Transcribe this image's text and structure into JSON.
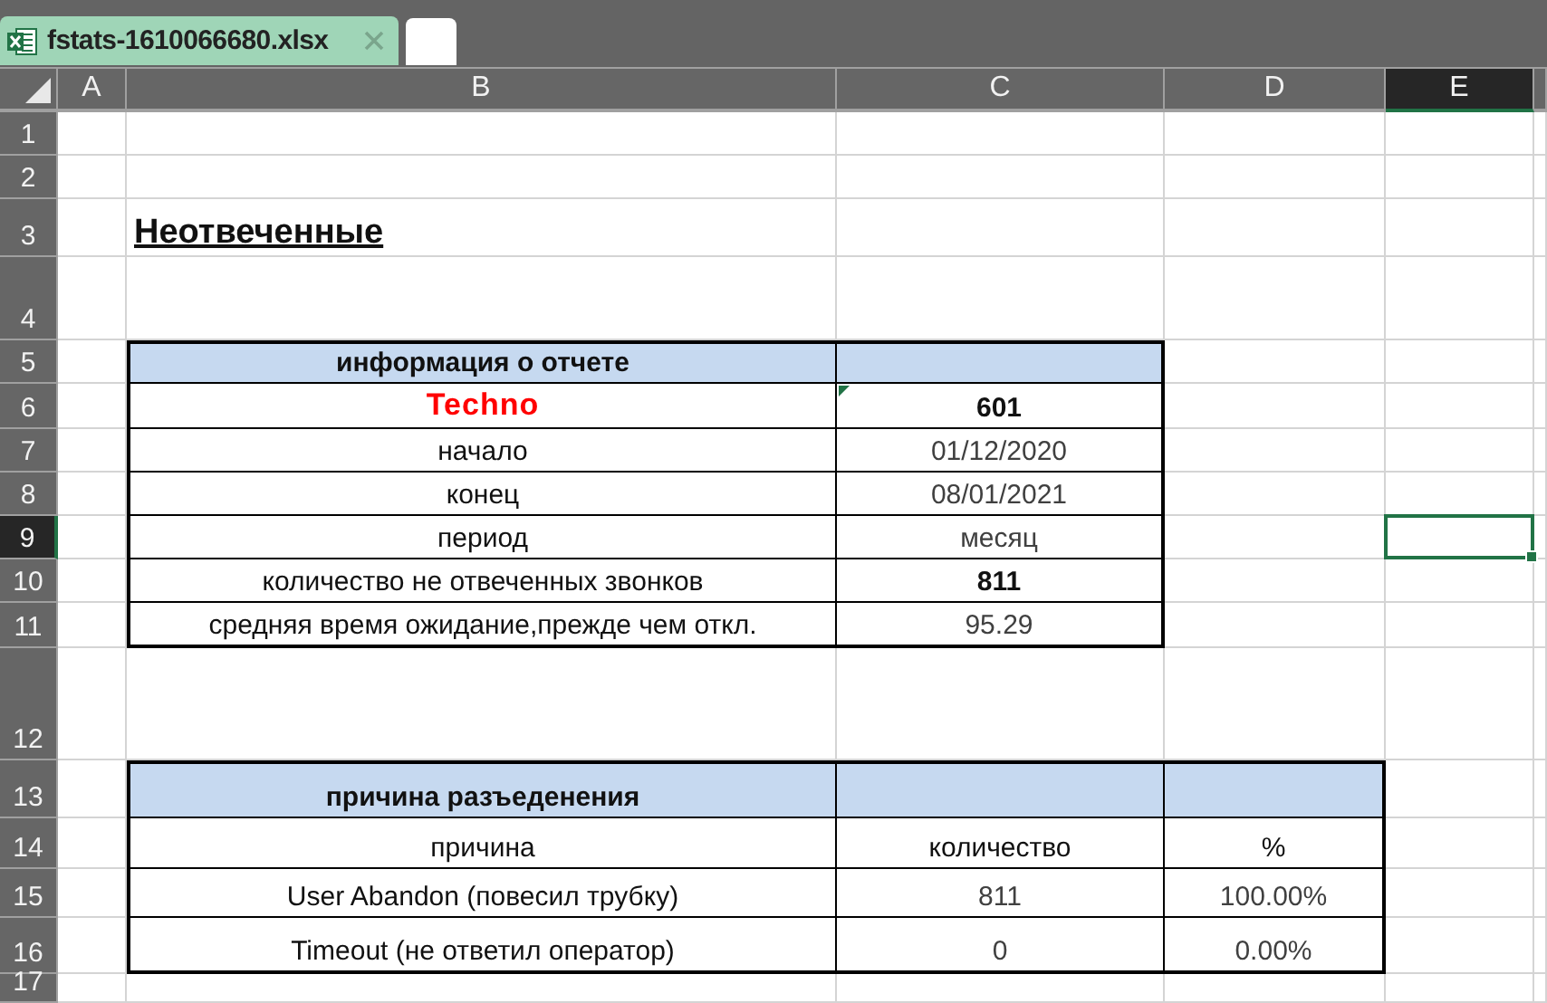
{
  "tabs": [
    {
      "label": "fstats-1610066680.xlsx",
      "selected": true
    }
  ],
  "columns": [
    {
      "label": "A",
      "selected": false
    },
    {
      "label": "B",
      "selected": false
    },
    {
      "label": "C",
      "selected": false
    },
    {
      "label": "D",
      "selected": false
    },
    {
      "label": "E",
      "selected": true
    }
  ],
  "rows": [
    {
      "label": "1",
      "selected": false
    },
    {
      "label": "2",
      "selected": false
    },
    {
      "label": "3",
      "selected": false
    },
    {
      "label": "4",
      "selected": false
    },
    {
      "label": "5",
      "selected": false
    },
    {
      "label": "6",
      "selected": false
    },
    {
      "label": "7",
      "selected": false
    },
    {
      "label": "8",
      "selected": false
    },
    {
      "label": "9",
      "selected": true
    },
    {
      "label": "10",
      "selected": false
    },
    {
      "label": "11",
      "selected": false
    },
    {
      "label": "12",
      "selected": false
    },
    {
      "label": "13",
      "selected": false
    },
    {
      "label": "14",
      "selected": false
    },
    {
      "label": "15",
      "selected": false
    },
    {
      "label": "16",
      "selected": false
    },
    {
      "label": "17",
      "selected": false
    }
  ],
  "title": "Неотвеченные",
  "report_info": {
    "header": "информация о отчете",
    "rows": [
      {
        "label": "Techno",
        "value": "601",
        "kind": "brand",
        "note_marker": true
      },
      {
        "label": "начало",
        "value": "01/12/2020",
        "kind": "plain",
        "note_marker": false
      },
      {
        "label": "конец",
        "value": "08/01/2021",
        "kind": "plain",
        "note_marker": false
      },
      {
        "label": "период",
        "value": "месяц",
        "kind": "plain",
        "note_marker": false
      },
      {
        "label": "количество не отвеченных звонков",
        "value": "811",
        "kind": "emphasis",
        "note_marker": false
      },
      {
        "label": "средняя время ожидание,прежде чем откл.",
        "value": "95.29",
        "kind": "plain",
        "note_marker": false
      }
    ]
  },
  "disconnect_table": {
    "header": "причина разъеденения",
    "columns": [
      "причина",
      "количество",
      "%"
    ],
    "rows": [
      {
        "reason": "User Abandon (повесил трубку)",
        "count": "811",
        "share": "100.00%"
      },
      {
        "reason": "Timeout (не ответил оператор)",
        "count": "0",
        "share": "0.00%"
      }
    ]
  }
}
